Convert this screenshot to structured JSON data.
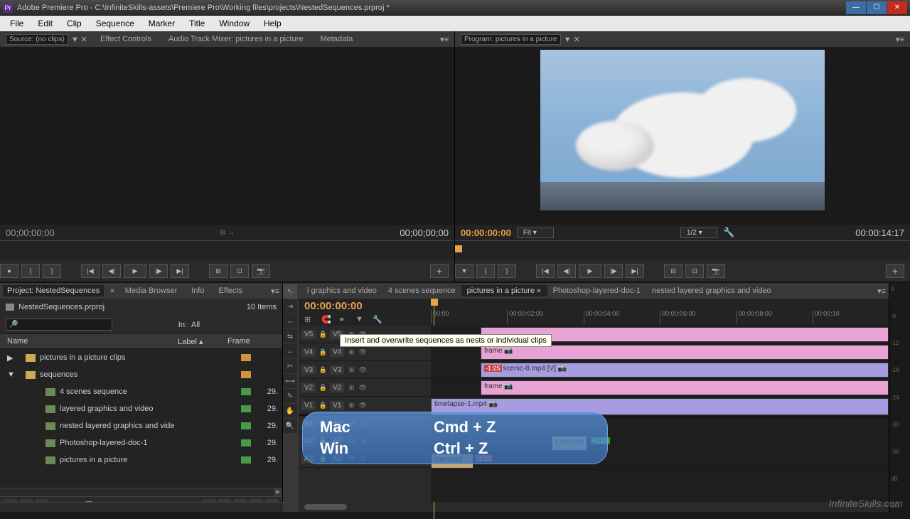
{
  "window": {
    "title": "Adobe Premiere Pro - C:\\InfiniteSkills-assets\\Premiere Pro\\Working files\\projects\\NestedSequences.prproj *"
  },
  "menu": [
    "File",
    "Edit",
    "Clip",
    "Sequence",
    "Marker",
    "Title",
    "Window",
    "Help"
  ],
  "source": {
    "dropdown": "Source: (no clips)",
    "tabs": [
      "Effect Controls",
      "Audio Track Mixer: pictures in a picture",
      "Metadata"
    ],
    "tc_left": "00;00;00;00",
    "tc_right": "00;00;00;00"
  },
  "program": {
    "label": "Program: pictures in a picture",
    "tc_left": "00:00:00:00",
    "fit": "Fit",
    "zoom": "1/2",
    "tc_right": "00:00:14:17"
  },
  "project": {
    "tabs": [
      "Project: NestedSequences",
      "Media Browser",
      "Info",
      "Effects"
    ],
    "file": "NestedSequences.prproj",
    "items_count": "10 Items",
    "filter_label": "In:",
    "filter_value": "All",
    "columns": {
      "name": "Name",
      "label": "Label",
      "frame": "Frame"
    },
    "tree": [
      {
        "exp": "▶",
        "ind": 1,
        "type": "folder",
        "name": "pictures in a picture clips",
        "color": "orange",
        "fr": ""
      },
      {
        "exp": "▼",
        "ind": 1,
        "type": "folder",
        "name": "sequences",
        "color": "orange",
        "fr": ""
      },
      {
        "exp": "",
        "ind": 3,
        "type": "seq",
        "name": "4 scenes sequence",
        "color": "green",
        "fr": "29."
      },
      {
        "exp": "",
        "ind": 3,
        "type": "seq",
        "name": "layered graphics and video",
        "color": "green",
        "fr": "29."
      },
      {
        "exp": "",
        "ind": 3,
        "type": "seq",
        "name": "nested layered graphics and vide",
        "color": "green",
        "fr": "29."
      },
      {
        "exp": "",
        "ind": 3,
        "type": "seq",
        "name": "Photoshop-layered-doc-1",
        "color": "green",
        "fr": "29."
      },
      {
        "exp": "",
        "ind": 3,
        "type": "seq",
        "name": "pictures in a picture",
        "color": "green",
        "fr": "29."
      }
    ]
  },
  "timeline": {
    "tabs": [
      "l graphics and video",
      "4 scenes sequence",
      "pictures in a picture",
      "Photoshop-layered-doc-1",
      "nested layered graphics and video"
    ],
    "active_tab": 2,
    "tc": "00:00:00:00",
    "ruler": [
      "00:00",
      "00:00:02:00",
      "00:00:04:00",
      "00:00:06:00",
      "00:00:08:00",
      "00:00:10"
    ],
    "tooltip": "Insert and overwrite sequences as nests or individual clips",
    "tracks": {
      "v5": {
        "name": "V5"
      },
      "v4": {
        "name": "V4",
        "clip": "frame"
      },
      "v3": {
        "name": "V3",
        "badge": "-1:25",
        "clip": "scenic-8.mp4 [V]"
      },
      "v2": {
        "name": "V2",
        "clip": "frame"
      },
      "v1": {
        "name": "V1",
        "clip": "timelapse-1.mp4"
      },
      "a1": {
        "name": "A1"
      },
      "a2": {
        "name": "A2",
        "clip": "Constant",
        "badge": "+1:25"
      },
      "a3": {
        "name": "A3",
        "clip": "Constant",
        "badge": "-1:10"
      }
    }
  },
  "audio_ticks": [
    "0",
    "-6",
    "-12",
    "-18",
    "-24",
    "-30",
    "-36",
    "dB"
  ],
  "shortcut": {
    "mac_label": "Mac",
    "mac_key": "Cmd + Z",
    "win_label": "Win",
    "win_key": "Ctrl + Z"
  },
  "watermark": "InfiniteSkills.com"
}
